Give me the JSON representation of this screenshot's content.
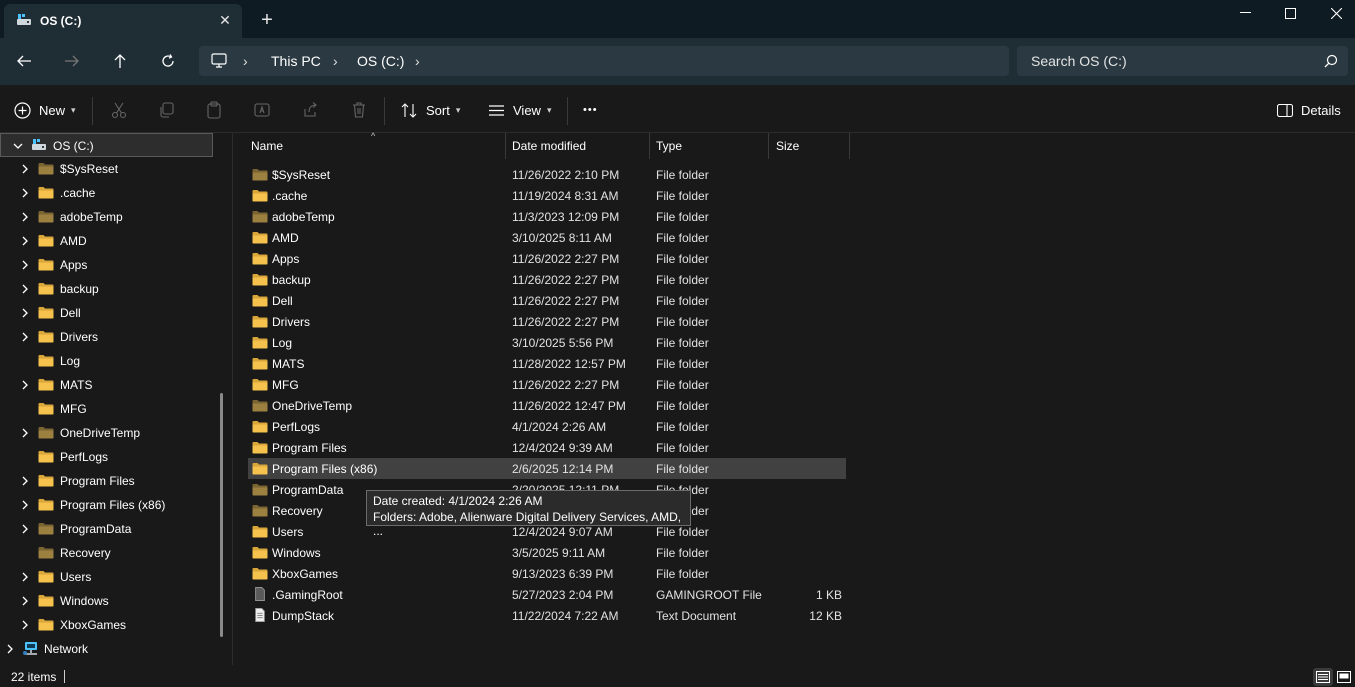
{
  "window": {
    "tab_title": "OS (C:)",
    "tab_close": "✕",
    "new_tab": "+",
    "minimize": "—",
    "maximize": "☐",
    "close": "✕"
  },
  "address_bar": {
    "crumbs": [
      "This PC",
      "OS (C:)"
    ],
    "search_placeholder": "Search OS (C:)"
  },
  "command_bar": {
    "new_label": "New",
    "sort_label": "Sort",
    "view_label": "View",
    "more_label": "•••",
    "details_label": "Details"
  },
  "nav_pane": {
    "root": "OS (C:)",
    "items": [
      {
        "label": "$SysReset",
        "expandable": true,
        "icon": "folder-dim-icon"
      },
      {
        "label": ".cache",
        "expandable": true,
        "icon": "folder-icon"
      },
      {
        "label": "adobeTemp",
        "expandable": true,
        "icon": "folder-dim-icon"
      },
      {
        "label": "AMD",
        "expandable": true,
        "icon": "folder-icon"
      },
      {
        "label": "Apps",
        "expandable": true,
        "icon": "folder-icon"
      },
      {
        "label": "backup",
        "expandable": true,
        "icon": "folder-icon"
      },
      {
        "label": "Dell",
        "expandable": true,
        "icon": "folder-icon"
      },
      {
        "label": "Drivers",
        "expandable": true,
        "icon": "folder-icon"
      },
      {
        "label": "Log",
        "expandable": false,
        "icon": "folder-icon"
      },
      {
        "label": "MATS",
        "expandable": true,
        "icon": "folder-icon"
      },
      {
        "label": "MFG",
        "expandable": false,
        "icon": "folder-icon"
      },
      {
        "label": "OneDriveTemp",
        "expandable": true,
        "icon": "folder-dim-icon"
      },
      {
        "label": "PerfLogs",
        "expandable": false,
        "icon": "folder-icon"
      },
      {
        "label": "Program Files",
        "expandable": true,
        "icon": "folder-icon"
      },
      {
        "label": "Program Files (x86)",
        "expandable": true,
        "icon": "folder-icon"
      },
      {
        "label": "ProgramData",
        "expandable": true,
        "icon": "folder-dim-icon"
      },
      {
        "label": "Recovery",
        "expandable": false,
        "icon": "folder-dim-icon"
      },
      {
        "label": "Users",
        "expandable": true,
        "icon": "folder-icon"
      },
      {
        "label": "Windows",
        "expandable": true,
        "icon": "folder-icon"
      },
      {
        "label": "XboxGames",
        "expandable": true,
        "icon": "folder-icon"
      }
    ],
    "network": "Network"
  },
  "file_list": {
    "headers": {
      "name": "Name",
      "date": "Date modified",
      "type": "Type",
      "size": "Size"
    },
    "rows": [
      {
        "name": "$SysReset",
        "date": "11/26/2022 2:10 PM",
        "type": "File folder",
        "size": "",
        "icon": "folder-dim-icon"
      },
      {
        "name": ".cache",
        "date": "11/19/2024 8:31 AM",
        "type": "File folder",
        "size": "",
        "icon": "folder-icon"
      },
      {
        "name": "adobeTemp",
        "date": "11/3/2023 12:09 PM",
        "type": "File folder",
        "size": "",
        "icon": "folder-dim-icon"
      },
      {
        "name": "AMD",
        "date": "3/10/2025 8:11 AM",
        "type": "File folder",
        "size": "",
        "icon": "folder-icon"
      },
      {
        "name": "Apps",
        "date": "11/26/2022 2:27 PM",
        "type": "File folder",
        "size": "",
        "icon": "folder-icon"
      },
      {
        "name": "backup",
        "date": "11/26/2022 2:27 PM",
        "type": "File folder",
        "size": "",
        "icon": "folder-icon"
      },
      {
        "name": "Dell",
        "date": "11/26/2022 2:27 PM",
        "type": "File folder",
        "size": "",
        "icon": "folder-icon"
      },
      {
        "name": "Drivers",
        "date": "11/26/2022 2:27 PM",
        "type": "File folder",
        "size": "",
        "icon": "folder-icon"
      },
      {
        "name": "Log",
        "date": "3/10/2025 5:56 PM",
        "type": "File folder",
        "size": "",
        "icon": "folder-icon"
      },
      {
        "name": "MATS",
        "date": "11/28/2022 12:57 PM",
        "type": "File folder",
        "size": "",
        "icon": "folder-icon"
      },
      {
        "name": "MFG",
        "date": "11/26/2022 2:27 PM",
        "type": "File folder",
        "size": "",
        "icon": "folder-icon"
      },
      {
        "name": "OneDriveTemp",
        "date": "11/26/2022 12:47 PM",
        "type": "File folder",
        "size": "",
        "icon": "folder-dim-icon"
      },
      {
        "name": "PerfLogs",
        "date": "4/1/2024 2:26 AM",
        "type": "File folder",
        "size": "",
        "icon": "folder-icon"
      },
      {
        "name": "Program Files",
        "date": "12/4/2024 9:39 AM",
        "type": "File folder",
        "size": "",
        "icon": "folder-icon"
      },
      {
        "name": "Program Files (x86)",
        "date": "2/6/2025 12:14 PM",
        "type": "File folder",
        "size": "",
        "icon": "folder-icon"
      },
      {
        "name": "ProgramData",
        "date": "2/20/2025 12:11 PM",
        "type": "File folder",
        "size": "",
        "icon": "folder-dim-icon"
      },
      {
        "name": "Recovery",
        "date": "",
        "type": "File folder",
        "size": "",
        "icon": "folder-dim-icon"
      },
      {
        "name": "Users",
        "date": "12/4/2024 9:07 AM",
        "type": "File folder",
        "size": "",
        "icon": "folder-icon"
      },
      {
        "name": "Windows",
        "date": "3/5/2025 9:11 AM",
        "type": "File folder",
        "size": "",
        "icon": "folder-icon"
      },
      {
        "name": "XboxGames",
        "date": "9/13/2023 6:39 PM",
        "type": "File folder",
        "size": "",
        "icon": "folder-icon"
      },
      {
        "name": ".GamingRoot",
        "date": "5/27/2023 2:04 PM",
        "type": "GAMINGROOT File",
        "size": "1 KB",
        "icon": "file-icon"
      },
      {
        "name": "DumpStack",
        "date": "11/22/2024 7:22 AM",
        "type": "Text Document",
        "size": "12 KB",
        "icon": "text-file-icon"
      }
    ],
    "selected_index": 14
  },
  "tooltip": {
    "line1": "Date created: 4/1/2024 2:26 AM",
    "line2": "Folders: Adobe, Alienware Digital Delivery Services, AMD, ..."
  },
  "status_bar": {
    "item_count": "22 items"
  },
  "colors": {
    "folder": "#f4c24d",
    "folder_dim": "#9c8040",
    "selection": "#414141",
    "accent": "#4cc2ff"
  }
}
